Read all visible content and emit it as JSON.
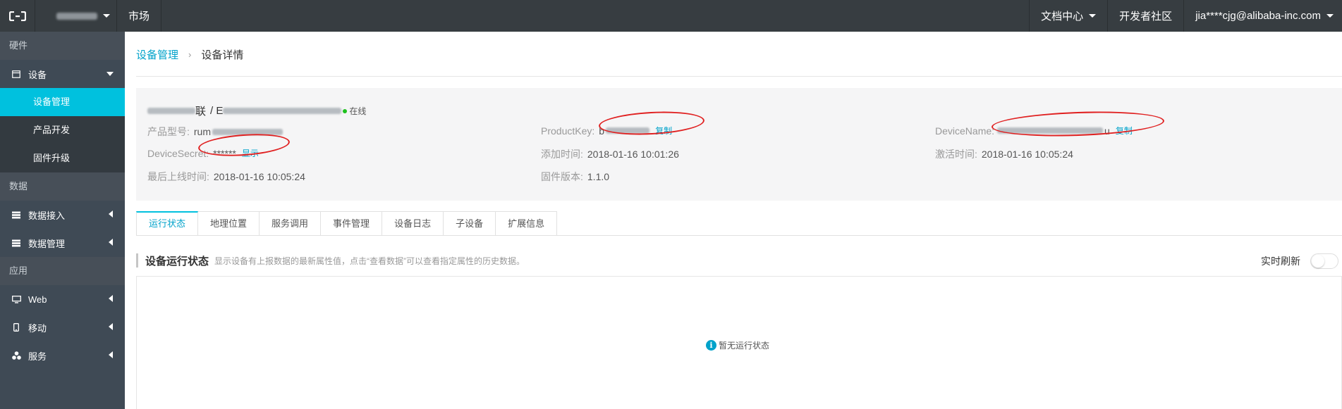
{
  "topbar": {
    "market": "市场",
    "docs": "文档中心",
    "community": "开发者社区",
    "user": "jia****cjg@alibaba-inc.com"
  },
  "sidebar": {
    "section_hardware": "硬件",
    "device_group": "设备",
    "device_items": [
      "设备管理",
      "产品开发",
      "固件升级"
    ],
    "section_data": "数据",
    "data_access": "数据接入",
    "data_manage": "数据管理",
    "section_app": "应用",
    "web": "Web",
    "mobile": "移动",
    "service": "服务"
  },
  "breadcrumb": {
    "parent": "设备管理",
    "current": "设备详情"
  },
  "device": {
    "title_suffix": "联",
    "title_sep": "/ E",
    "status": "在线",
    "product_model_label": "产品型号:",
    "product_model_value": "rum",
    "product_key_label": "ProductKey:",
    "product_key_value": "b",
    "copy_label": "复制",
    "device_name_label": "DeviceName:",
    "device_name_value": "u",
    "device_secret_label": "DeviceSecret:",
    "device_secret_value": "******",
    "show_label": "显示",
    "added_label": "添加时间:",
    "added_value": "2018-01-16 10:01:26",
    "activated_label": "激活时间:",
    "activated_value": "2018-01-16 10:05:24",
    "last_online_label": "最后上线时间:",
    "last_online_value": "2018-01-16 10:05:24",
    "firmware_label": "固件版本:",
    "firmware_value": "1.1.0"
  },
  "tabs": [
    "运行状态",
    "地理位置",
    "服务调用",
    "事件管理",
    "设备日志",
    "子设备",
    "扩展信息"
  ],
  "active_tab": 0,
  "status_section": {
    "title": "设备运行状态",
    "desc": "显示设备有上报数据的最新属性值，点击“查看数据”可以查看指定属性的历史数据。",
    "realtime_label": "实时刷新",
    "realtime_on": false,
    "empty_text": "暂无运行状态"
  },
  "colors": {
    "accent": "#00c1de",
    "link": "#00a2ca",
    "topbar": "#373d41",
    "sidebar": "#3f4a55",
    "annotation": "#e02020"
  }
}
